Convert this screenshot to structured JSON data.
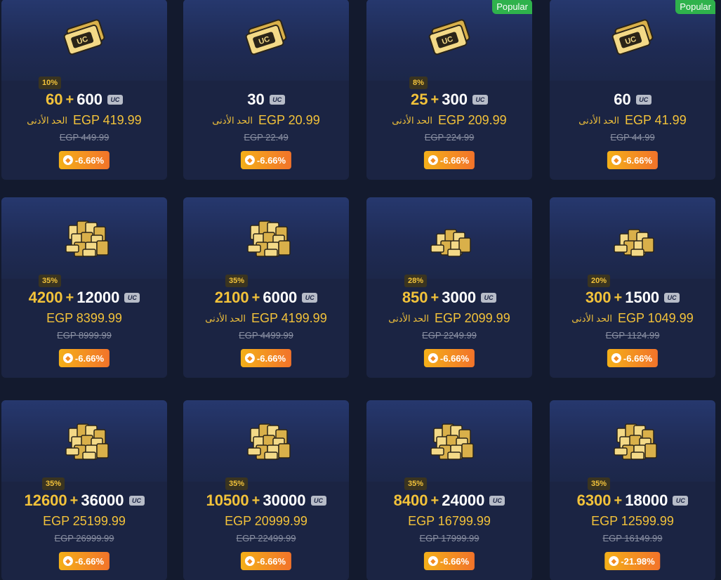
{
  "common": {
    "min_label": "الحد الأدنى",
    "uc_label": "UC",
    "popular_label": "Popular",
    "discount_icon_glyph": "◆"
  },
  "colors": {
    "page_bg": "#131a2e",
    "card_bg": "#1b2443",
    "accent_gold": "#f2c23a",
    "popular_green": "#2fb24c",
    "discount_orange": "#f2732a"
  },
  "packages": [
    {
      "bonus_pct": "10%",
      "bonus": "60",
      "amount": "600",
      "price": "EGP 419.99",
      "show_min": true,
      "old_price": "EGP 449.99",
      "discount": "-6.66%",
      "popular": false,
      "icon": "uc-small-stack-icon"
    },
    {
      "bonus_pct": "",
      "bonus": "",
      "amount": "30",
      "price": "EGP 20.99",
      "show_min": true,
      "old_price": "EGP 22.49",
      "discount": "-6.66%",
      "popular": false,
      "icon": "uc-card-icon"
    },
    {
      "bonus_pct": "8%",
      "bonus": "25",
      "amount": "300",
      "price": "EGP 209.99",
      "show_min": true,
      "old_price": "EGP 224.99",
      "discount": "-6.66%",
      "popular": true,
      "icon": "uc-card-icon"
    },
    {
      "bonus_pct": "",
      "bonus": "",
      "amount": "60",
      "price": "EGP 41.99",
      "show_min": true,
      "old_price": "EGP 44.99",
      "discount": "-6.66%",
      "popular": true,
      "icon": "uc-card-icon"
    },
    {
      "bonus_pct": "35%",
      "bonus": "4200",
      "amount": "12000",
      "price": "EGP 8399.99",
      "show_min": false,
      "old_price": "EGP 8999.99",
      "discount": "-6.66%",
      "popular": false,
      "icon": "uc-large-pile-icon"
    },
    {
      "bonus_pct": "35%",
      "bonus": "2100",
      "amount": "6000",
      "price": "EGP 4199.99",
      "show_min": true,
      "old_price": "EGP 4499.99",
      "discount": "-6.66%",
      "popular": false,
      "icon": "uc-large-pile-icon"
    },
    {
      "bonus_pct": "28%",
      "bonus": "850",
      "amount": "3000",
      "price": "EGP 2099.99",
      "show_min": true,
      "old_price": "EGP 2249.99",
      "discount": "-6.66%",
      "popular": false,
      "icon": "uc-medium-pile-icon"
    },
    {
      "bonus_pct": "20%",
      "bonus": "300",
      "amount": "1500",
      "price": "EGP 1049.99",
      "show_min": true,
      "old_price": "EGP 1124.99",
      "discount": "-6.66%",
      "popular": false,
      "icon": "uc-medium-pile-icon"
    },
    {
      "bonus_pct": "35%",
      "bonus": "12600",
      "amount": "36000",
      "price": "EGP 25199.99",
      "show_min": false,
      "old_price": "EGP 26999.99",
      "discount": "-6.66%",
      "popular": false,
      "icon": "uc-large-pile-icon"
    },
    {
      "bonus_pct": "35%",
      "bonus": "10500",
      "amount": "30000",
      "price": "EGP 20999.99",
      "show_min": false,
      "old_price": "EGP 22499.99",
      "discount": "-6.66%",
      "popular": false,
      "icon": "uc-large-pile-icon"
    },
    {
      "bonus_pct": "35%",
      "bonus": "8400",
      "amount": "24000",
      "price": "EGP 16799.99",
      "show_min": false,
      "old_price": "EGP 17999.99",
      "discount": "-6.66%",
      "popular": false,
      "icon": "uc-large-pile-icon"
    },
    {
      "bonus_pct": "35%",
      "bonus": "6300",
      "amount": "18000",
      "price": "EGP 12599.99",
      "show_min": false,
      "old_price": "EGP 16149.99",
      "discount": "-21.98%",
      "popular": false,
      "icon": "uc-large-pile-icon"
    }
  ]
}
